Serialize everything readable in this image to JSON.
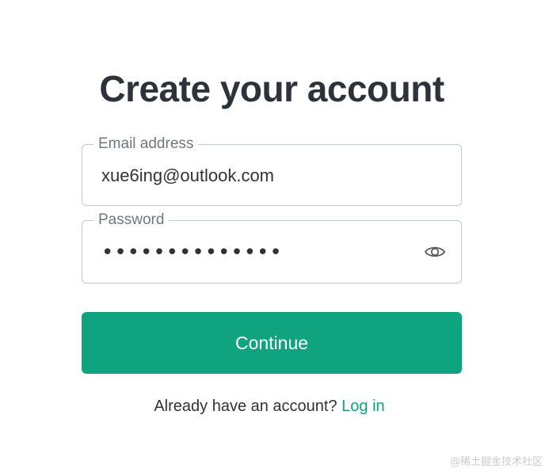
{
  "page": {
    "title": "Create your account"
  },
  "form": {
    "email": {
      "label": "Email address",
      "value": "xue6ing@outlook.com"
    },
    "password": {
      "label": "Password",
      "value": "••••••••••••••",
      "toggle_icon": "eye-icon"
    },
    "continue_label": "Continue"
  },
  "footer": {
    "prompt": "Already have an account?",
    "login_link": "Log in"
  },
  "watermark": "@稀土掘金技术社区",
  "colors": {
    "accent": "#10a37f",
    "text": "#2d333a",
    "muted": "#6f7780",
    "border": "#c2c8d0"
  }
}
